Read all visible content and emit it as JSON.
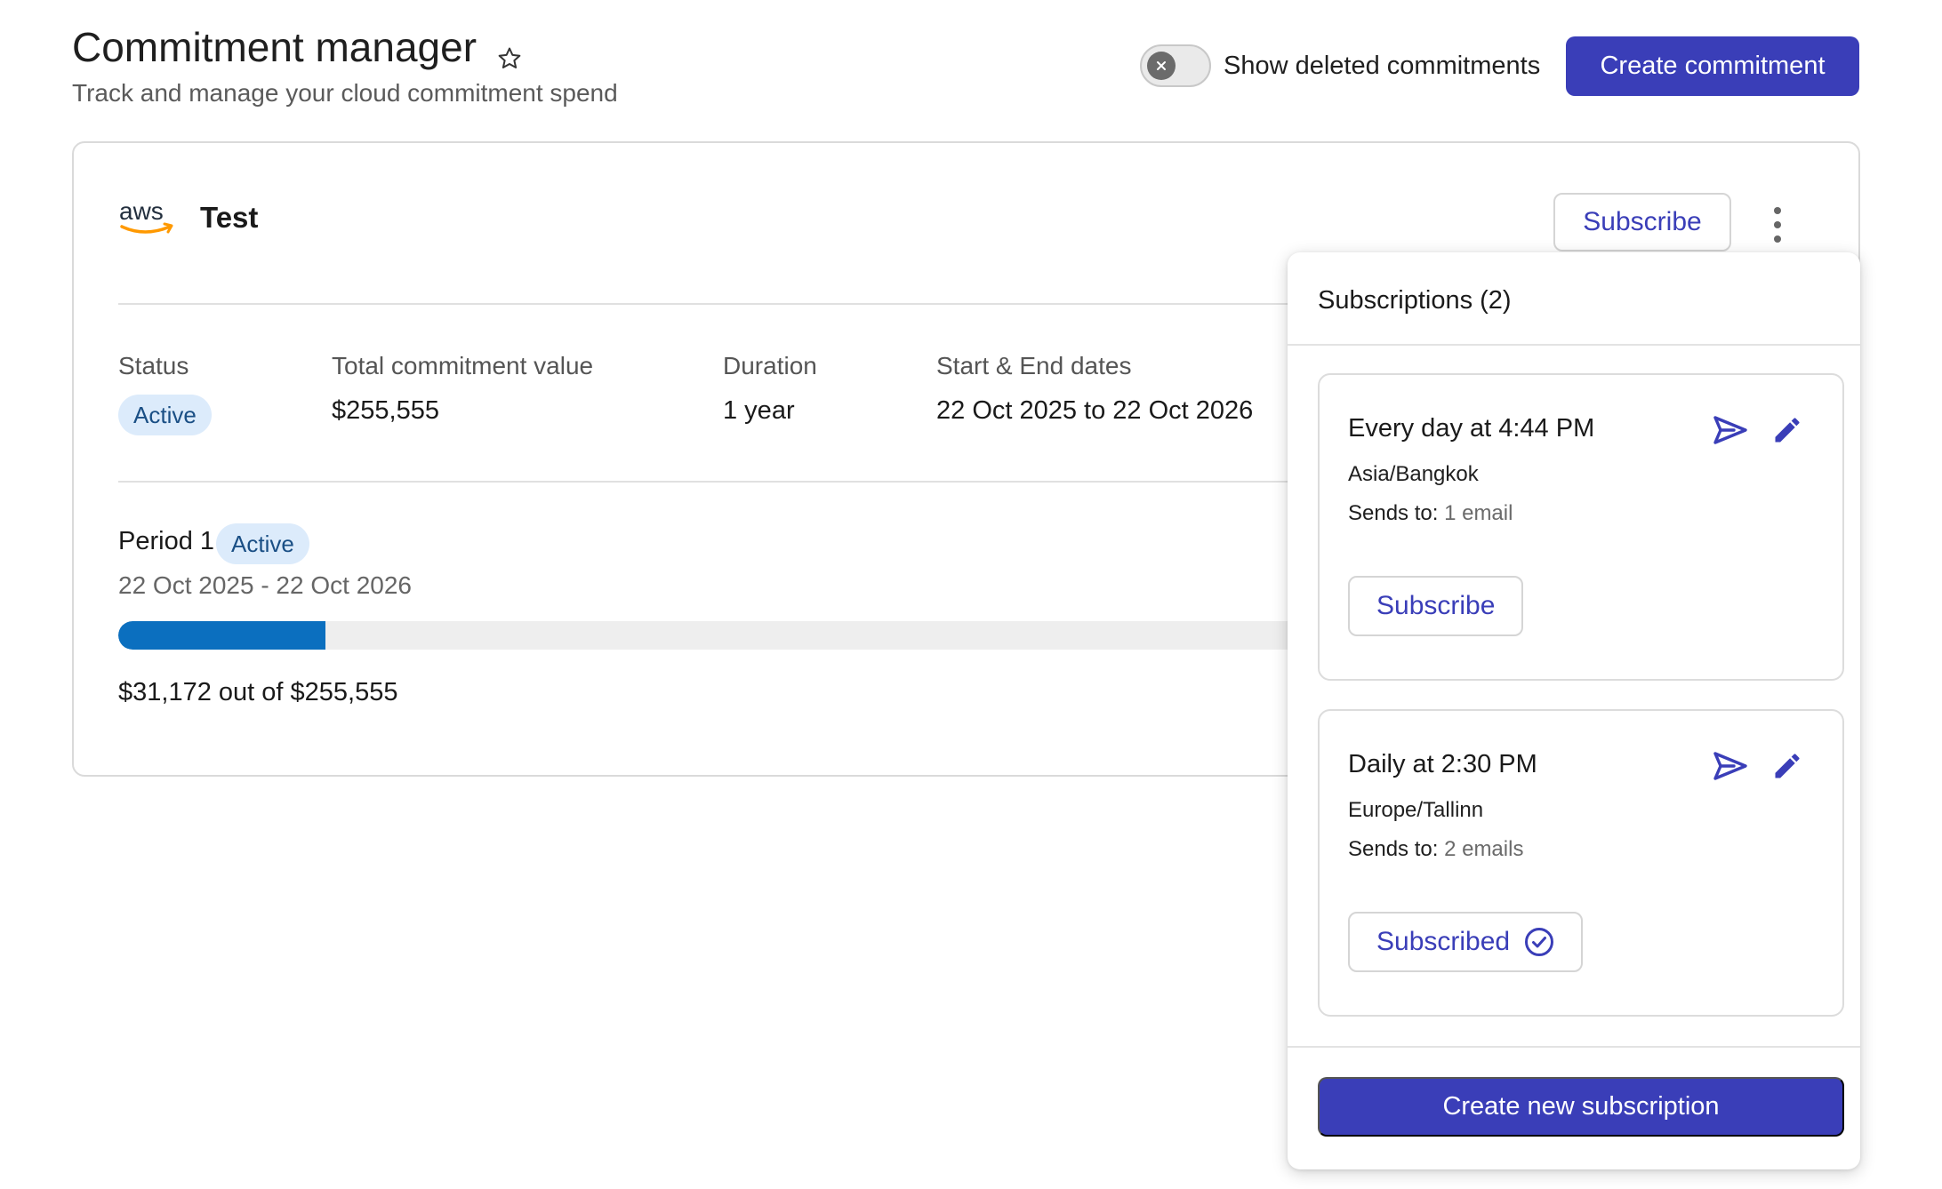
{
  "header": {
    "title": "Commitment manager",
    "subtitle": "Track and manage your cloud commitment spend",
    "toggle_label": "Show deleted commitments",
    "toggle_on": false,
    "create_button": "Create commitment"
  },
  "commitment": {
    "provider_logo": "aws",
    "name": "Test",
    "subscribe_button": "Subscribe",
    "menu_icon": "kebab-menu-icon",
    "stats": {
      "status_label": "Status",
      "status_value": "Active",
      "total_label": "Total commitment value",
      "total_value": "$255,555",
      "duration_label": "Duration",
      "duration_value": "1 year",
      "dates_label": "Start & End dates",
      "dates_value": "22 Oct 2025 to 22 Oct 2026"
    },
    "period": {
      "title": "Period 1",
      "status": "Active",
      "dates": "22 Oct 2025 - 22 Oct 2026",
      "spent": 31172,
      "total": 255555,
      "progress_text": "$31,172 out of $255,555"
    }
  },
  "subscriptions_popup": {
    "title": "Subscriptions (2)",
    "items": [
      {
        "schedule": "Every day at 4:44 PM",
        "timezone": "Asia/Bangkok",
        "sends_label": "Sends to:",
        "sends_value": "1 email",
        "button": "Subscribe",
        "subscribed": false
      },
      {
        "schedule": "Daily at 2:30 PM",
        "timezone": "Europe/Tallinn",
        "sends_label": "Sends to:",
        "sends_value": "2 emails",
        "button": "Subscribed",
        "subscribed": true
      }
    ],
    "create_button": "Create new subscription"
  },
  "colors": {
    "primary": "#3a3eb8",
    "progress": "#0b6fbf",
    "badge_bg": "#dcebfb",
    "badge_text": "#1a4f85"
  }
}
